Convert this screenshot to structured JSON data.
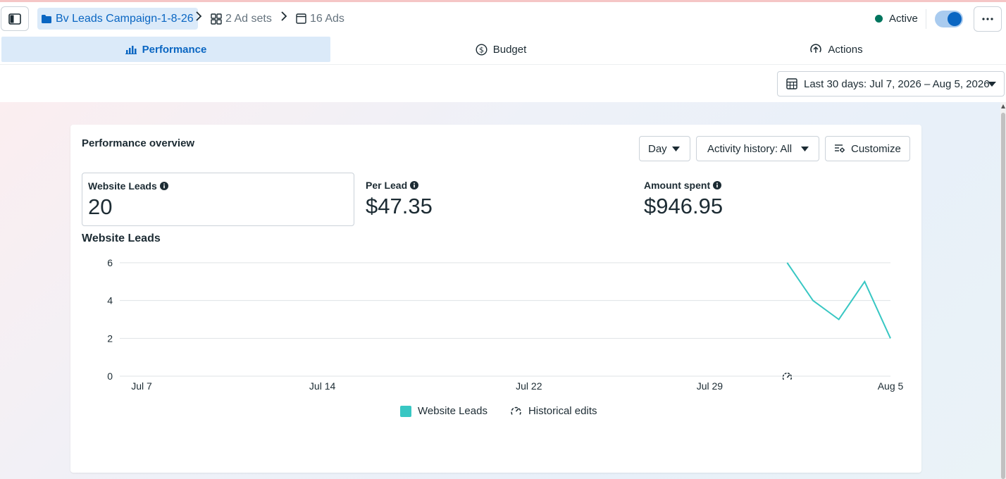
{
  "breadcrumb": {
    "campaign": "Bv Leads Campaign-1-8-26",
    "ad_sets": "2 Ad sets",
    "ads": "16 Ads"
  },
  "status": {
    "label": "Active",
    "toggle_on": true
  },
  "tabs": [
    {
      "label": "Performance",
      "icon": "bar-chart-icon",
      "active": true
    },
    {
      "label": "Budget",
      "icon": "dollar-circle-icon",
      "active": false
    },
    {
      "label": "Actions",
      "icon": "arrow-up-circle-icon",
      "active": false
    }
  ],
  "date_range": {
    "label": "Last 30 days: Jul 7, 2026 – Aug 5, 2026"
  },
  "overview": {
    "title": "Performance overview",
    "granularity": "Day",
    "activity_history": "Activity history: All",
    "customize": "Customize"
  },
  "metrics": [
    {
      "label": "Website Leads",
      "value": "20",
      "selected": true
    },
    {
      "label": "Per Lead",
      "value": "$47.35",
      "selected": false
    },
    {
      "label": "Amount spent",
      "value": "$946.95",
      "selected": false
    }
  ],
  "chart_data": {
    "type": "line",
    "title": "Website Leads",
    "x": [
      "Aug 1",
      "Aug 2",
      "Aug 3",
      "Aug 4",
      "Aug 5"
    ],
    "series": [
      {
        "name": "Website Leads",
        "values": [
          6,
          4,
          3,
          5,
          2
        ]
      }
    ],
    "x_ticks": [
      "Jul 7",
      "Jul 14",
      "Jul 22",
      "Jul 29",
      "Aug 5"
    ],
    "y_ticks": [
      0,
      2,
      4,
      6
    ],
    "ylim": [
      0,
      6
    ],
    "grid": true,
    "legend_position": "bottom",
    "legend": [
      "Website Leads",
      "Historical edits"
    ],
    "historical_edit_markers": [
      "Aug 1"
    ],
    "series_color": "#38c7c3"
  },
  "colors": {
    "accent": "#0a66c2",
    "active_status": "#00755e"
  }
}
